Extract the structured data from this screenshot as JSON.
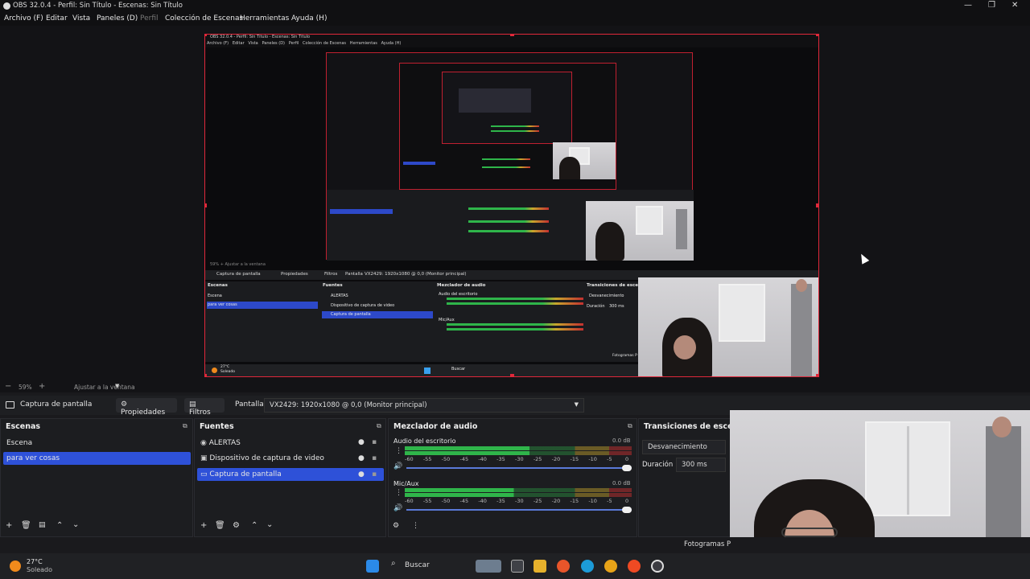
{
  "window": {
    "title": "OBS 32.0.4 - Perfil: Sin Título - Escenas: Sin Título",
    "minimize": "—",
    "maximize": "❐",
    "close": "✕"
  },
  "menu": {
    "items": [
      "Archivo (F)",
      "Editar",
      "Vista",
      "Paneles (D)",
      "Perfil",
      "Colección de Escenas",
      "Herramientas",
      "Ayuda (H)"
    ]
  },
  "nested_preview": {
    "title": "OBS 32.0.4 - Perfil: Sin Título - Escenas: Sin Título",
    "menu": "Archivo (F)   Editar   Vista   Paneles (D)   Perfil   Colección de Escenas   Herramientas   Ayuda (H)",
    "zoom": "59%   +   Ajustar a la ventana",
    "src_label": "Captura de pantalla",
    "props": "Propiedades",
    "filters": "Filtros",
    "pantalla": "Pantalla",
    "monitor": "VX2429: 1920x1080 @ 0,0 (Monitor principal)",
    "docks": [
      "Escenas",
      "Fuentes",
      "Mezclador de audio",
      "Transiciones de escena"
    ],
    "scenes": [
      "Escena",
      "para ver cosas"
    ],
    "sources": [
      "ALERTAS",
      "Dispositivo de captura de video",
      "Captura de pantalla"
    ],
    "audio1": "Audio del escritorio",
    "audio2": "Mic/Aux",
    "trans": "Desvanecimiento",
    "dur_label": "Duración",
    "dur": "300 ms",
    "fps": "Fotogramas P",
    "temp": "27°C",
    "weather": "Soleado",
    "search": "Buscar"
  },
  "zoom": {
    "minus": "−",
    "level": "59%",
    "plus": "+",
    "fit": "Ajustar a la ventana",
    "caret": "▼"
  },
  "source_toolbar": {
    "source_name": "Captura de pantalla",
    "properties": "Propiedades",
    "filters": "Filtros",
    "display_label": "Pantalla",
    "display_value": "VX2429: 1920x1080 @ 0,0 (Monitor principal)"
  },
  "scenes_dock": {
    "title": "Escenas",
    "items": [
      "Escena",
      "para ver cosas"
    ],
    "selected": 1
  },
  "sources_dock": {
    "title": "Fuentes",
    "items": [
      "ALERTAS",
      "Dispositivo de captura de video",
      "Captura de pantalla"
    ],
    "selected": 2
  },
  "mixer_dock": {
    "title": "Mezclador de audio",
    "channels": [
      {
        "name": "Audio del escritorio",
        "db": "0.0 dB",
        "level": 0.55
      },
      {
        "name": "Mic/Aux",
        "db": "0.0 dB",
        "level": 0.48
      }
    ],
    "ticks": [
      "-60",
      "-55",
      "-50",
      "-45",
      "-40",
      "-35",
      "-30",
      "-25",
      "-20",
      "-15",
      "-10",
      "-5",
      "0"
    ]
  },
  "transitions_dock": {
    "title": "Transiciones de escena",
    "transition": "Desvanecimiento",
    "duration_label": "Duración",
    "duration_value": "300 ms"
  },
  "status": {
    "fps": "Fotogramas P"
  },
  "taskbar": {
    "temp": "27°C",
    "weather": "Soleado",
    "search": "Buscar"
  },
  "colors": {
    "accent": "#2e51d8",
    "canvas_border": "#e0283a",
    "meter_green": "#2fb54a",
    "meter_yellow": "#c8a72c",
    "meter_red": "#c43030"
  }
}
